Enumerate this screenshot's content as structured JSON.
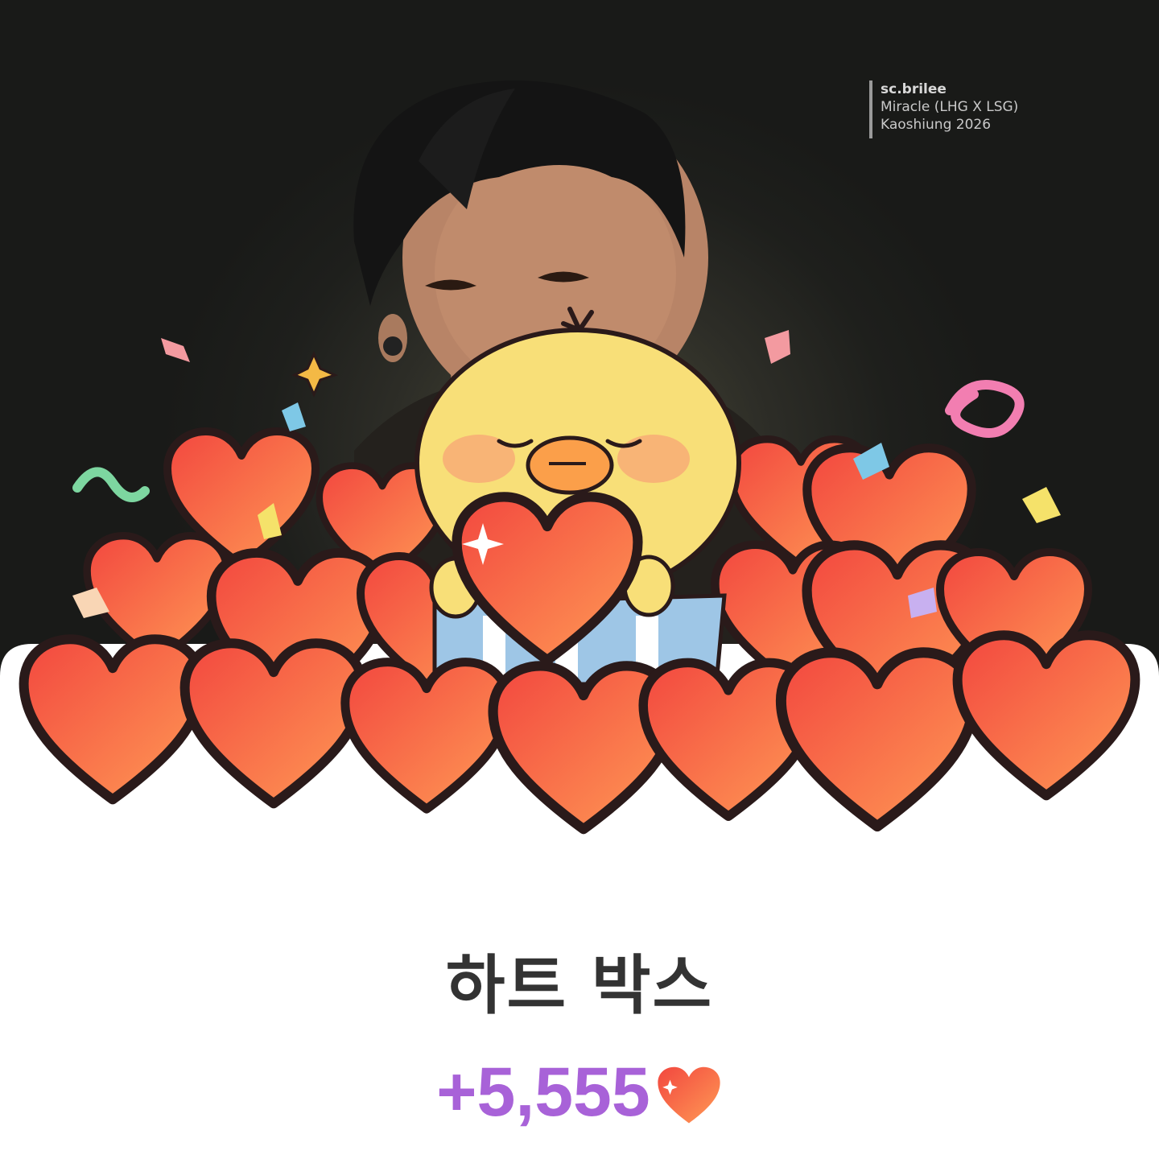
{
  "watermark": {
    "handle": "sc.brilee",
    "line2": "Miracle (LHG X LSG)",
    "line3": "Kaoshiung 2026"
  },
  "title": "하트 박스",
  "reward": {
    "amount": "+5,555",
    "icon": "heart-icon"
  },
  "colors": {
    "title": "#333333",
    "amount": "#a862d8",
    "heart_light": "#ff9a50",
    "heart_dark": "#f2473f",
    "chick": "#f8df78"
  }
}
